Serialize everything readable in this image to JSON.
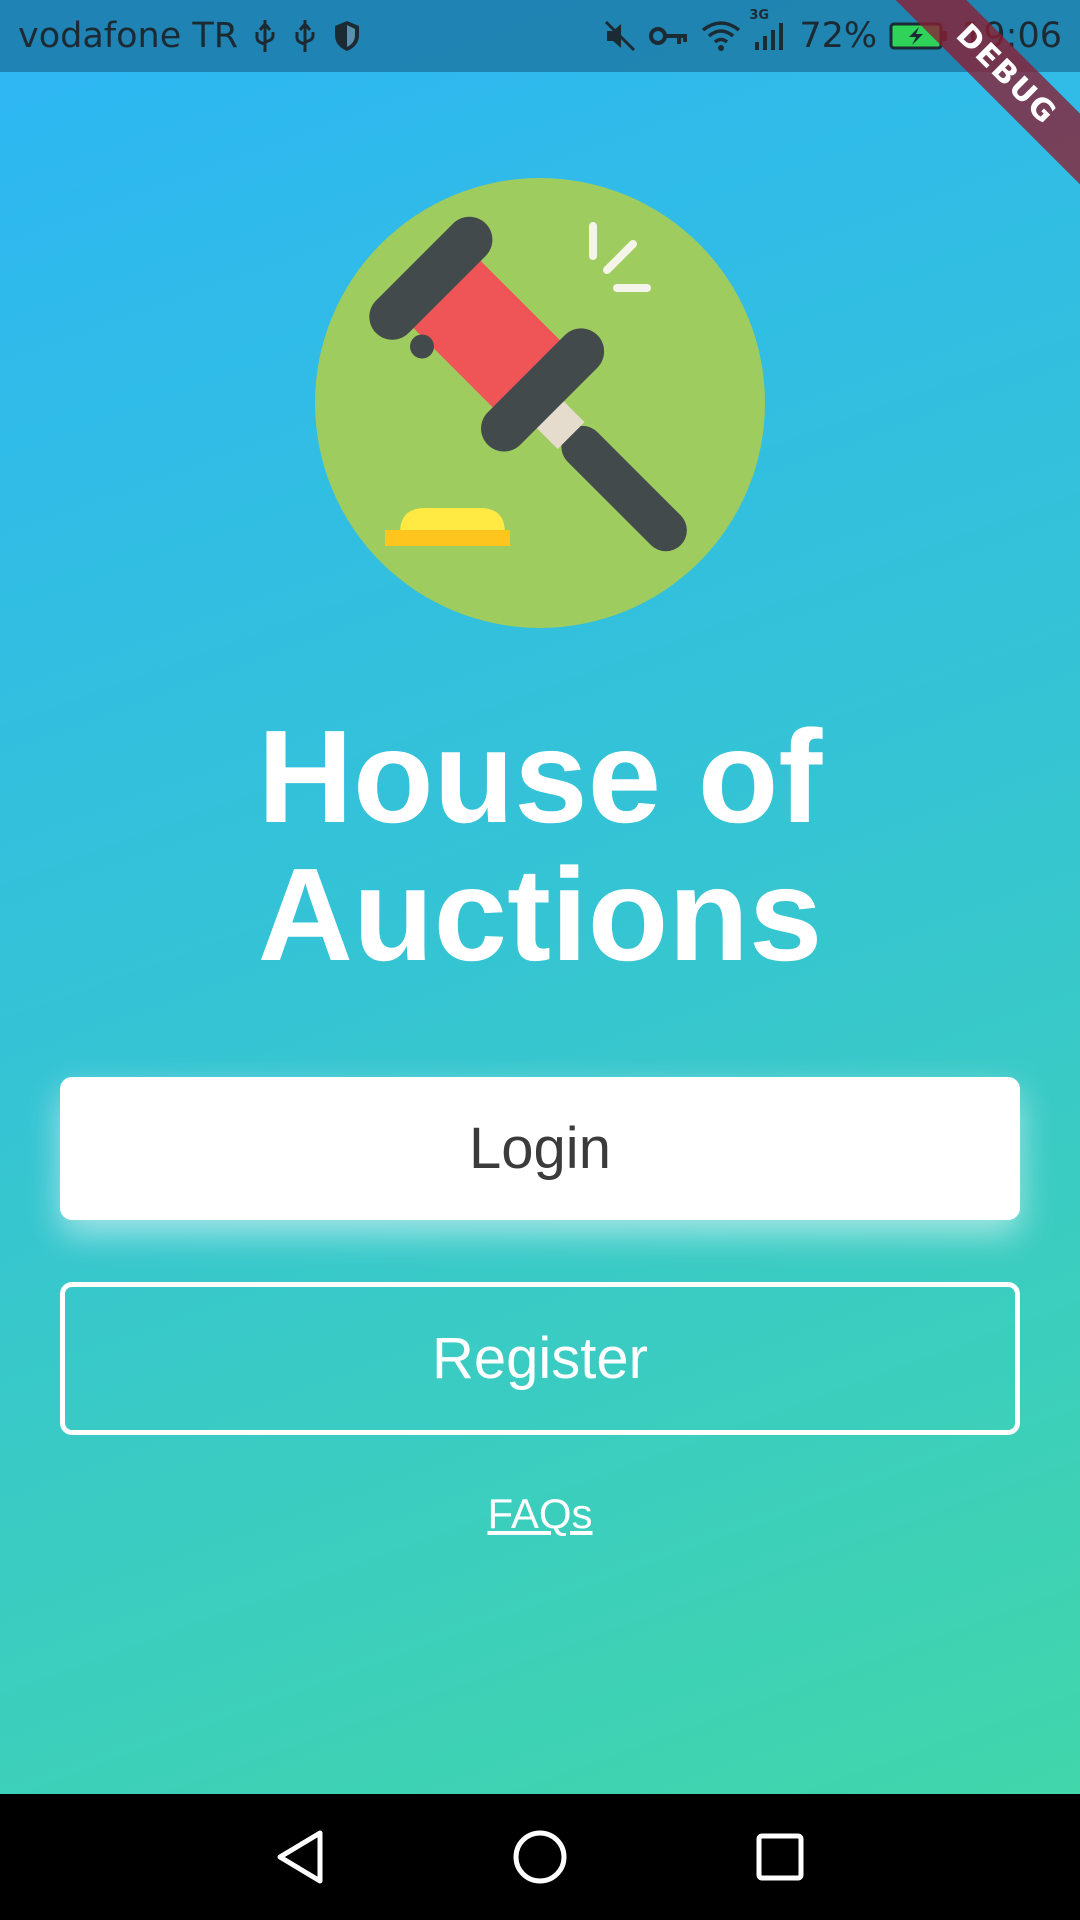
{
  "status_bar": {
    "carrier": "vodafone TR",
    "network_type": "3G",
    "battery": "72%",
    "time": "19:06",
    "icons_left": [
      "usb-icon",
      "usb-icon",
      "shield-icon"
    ],
    "icons_right": [
      "mute-icon",
      "vpn-key-icon",
      "wifi-icon",
      "signal-icon",
      "battery-charging-icon"
    ]
  },
  "debug_banner": "DEBUG",
  "logo": {
    "icon": "gavel-icon",
    "colors": {
      "circle": "#9FCC5E",
      "head": "#EF5556",
      "dark": "#434A4C",
      "collar": "#E6DCCD",
      "block_top": "#FFE942",
      "block_base": "#FFC51F"
    }
  },
  "title": {
    "line1": "House of",
    "line2": "Auctions"
  },
  "buttons": {
    "login": "Login",
    "register": "Register"
  },
  "faqs": "FAQs",
  "nav": {
    "icons": [
      "back-icon",
      "home-icon",
      "recents-icon"
    ]
  },
  "colors": {
    "gradient_top": "#2DB6F5",
    "gradient_bottom": "#43D8A6"
  }
}
